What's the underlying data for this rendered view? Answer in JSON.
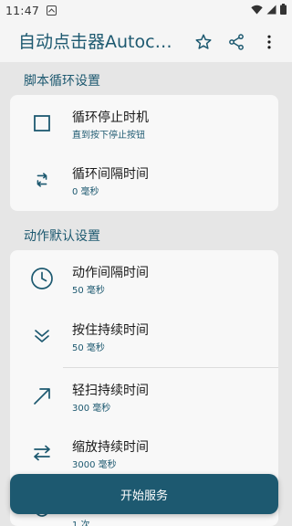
{
  "status_bar": {
    "time": "11:47",
    "icons": [
      "notification-icon",
      "wifi-icon",
      "signal-icon",
      "battery-icon"
    ]
  },
  "app_bar": {
    "title": "自动点击器Autocl...",
    "actions": [
      "star-icon",
      "share-icon",
      "more-vert-icon"
    ]
  },
  "sections": {
    "script_loop": {
      "header": "脚本循环设置",
      "items": [
        {
          "icon": "checkbox-outline-icon",
          "title": "循环停止时机",
          "subtitle": "直到按下停止按钮"
        },
        {
          "icon": "repeat-icon",
          "title": "循环间隔时间",
          "subtitle": "0 毫秒"
        }
      ]
    },
    "action_defaults": {
      "header": "动作默认设置",
      "items": [
        {
          "icon": "clock-icon",
          "title": "动作间隔时间",
          "subtitle": "50 毫秒"
        },
        {
          "icon": "double-chevron-down-icon",
          "title": "按住持续时间",
          "subtitle": "50 毫秒"
        },
        {
          "icon": "arrow-diagonal-icon",
          "title": "轻扫持续时间",
          "subtitle": "300 毫秒"
        },
        {
          "icon": "swap-horizontal-icon",
          "title": "缩放持续时间",
          "subtitle": "3000 毫秒"
        },
        {
          "icon": "refresh-icon",
          "title": "",
          "subtitle": "1 次"
        }
      ]
    }
  },
  "fab": {
    "label": "开始服务"
  },
  "colors": {
    "accent": "#1d5970",
    "background": "#e6e6e6",
    "card": "#f8f8f8"
  }
}
